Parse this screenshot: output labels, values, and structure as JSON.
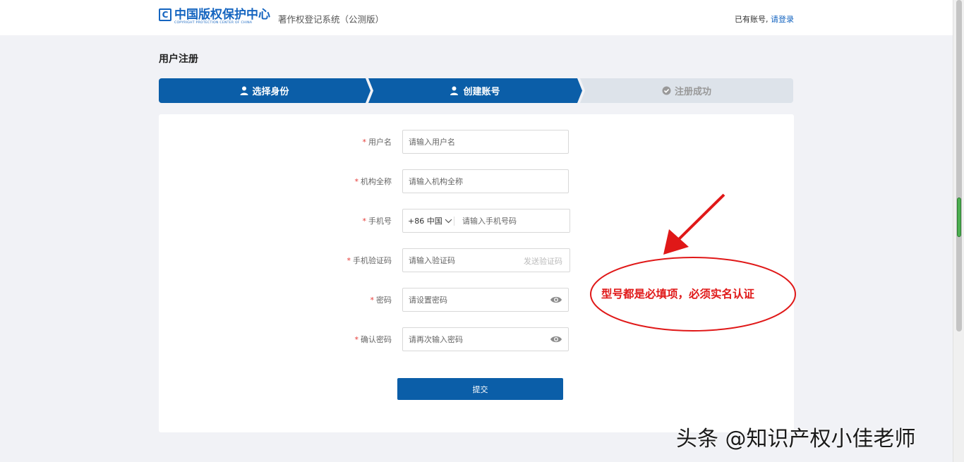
{
  "header": {
    "logo_cn": "中国版权保护中心",
    "logo_en": "COPYRIGHT PROTECTION CENTER OF CHINA",
    "system_title": "著作权登记系统（公测版）",
    "have_account": "已有账号,",
    "login_link": "请登录"
  },
  "page": {
    "title": "用户注册"
  },
  "steps": [
    {
      "label": "选择身份",
      "icon": "user-icon",
      "state": "done"
    },
    {
      "label": "创建账号",
      "icon": "user-add-icon",
      "state": "active"
    },
    {
      "label": "注册成功",
      "icon": "check-circle-icon",
      "state": "pending"
    }
  ],
  "form": {
    "username": {
      "label": "用户名",
      "placeholder": "请输入用户名",
      "value": ""
    },
    "org_name": {
      "label": "机构全称",
      "placeholder": "请输入机构全称",
      "value": ""
    },
    "phone": {
      "label": "手机号",
      "country_code": "+86 中国",
      "placeholder": "请输入手机号码",
      "value": ""
    },
    "sms_code": {
      "label": "手机验证码",
      "placeholder": "请输入验证码",
      "send_label": "发送验证码",
      "value": ""
    },
    "password": {
      "label": "密码",
      "placeholder": "请设置密码",
      "value": ""
    },
    "confirm_password": {
      "label": "确认密码",
      "placeholder": "请再次输入密码",
      "value": ""
    },
    "required_mark": "*",
    "submit_label": "提交"
  },
  "annotation": {
    "text": "型号都是必填项，必须实名认证",
    "color": "#e01818"
  },
  "watermark": {
    "text": "头条 @知识产权小佳老师"
  },
  "colors": {
    "primary": "#0b5ea8",
    "step_inactive": "#dde3ea",
    "required": "#e53935"
  }
}
